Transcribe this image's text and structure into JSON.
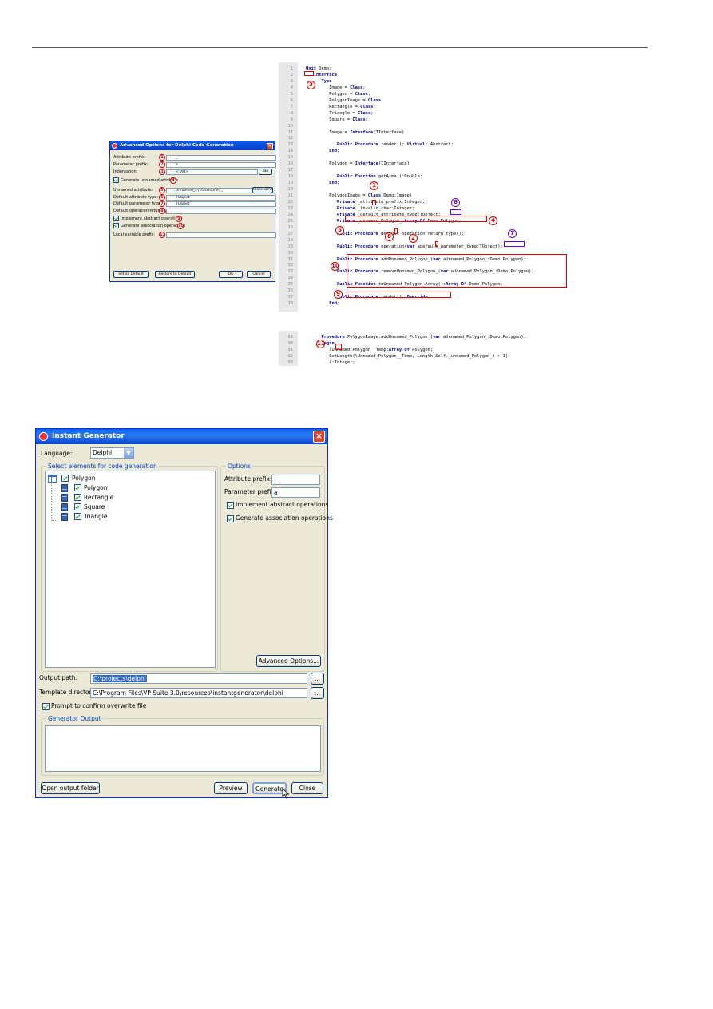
{
  "advanced_dialog": {
    "title": "Advanced Options for Delphi Code Generation",
    "rows": [
      {
        "label": "Attribute prefix:",
        "value": "_",
        "num": "1"
      },
      {
        "label": "Parameter prefix:",
        "value": "a",
        "num": "2"
      },
      {
        "label": "Indentation:",
        "value": "<TAB>",
        "num": "3",
        "button": "Tab"
      },
      {
        "label": "Generate unnamed attribute",
        "num": "4",
        "checkbox": true
      },
      {
        "label": "Unnamed attribute:",
        "value": "Unnamed_${classname}_",
        "num": "5",
        "button": "Classname"
      },
      {
        "label": "Default attribute type:",
        "value": "TObject",
        "num": "6"
      },
      {
        "label": "Default parameter type:",
        "value": "TObject",
        "num": "7"
      },
      {
        "label": "Default operation return type:",
        "value": "",
        "num": "8"
      },
      {
        "label": "Implement abstract operations",
        "num": "9",
        "checkbox": true
      },
      {
        "label": "Generate association operations",
        "num": "10",
        "checkbox": true
      },
      {
        "label": "Local variable prefix:",
        "value": "l",
        "num": "11"
      }
    ],
    "buttons": {
      "set_default": "Set as Default",
      "restore": "Restore to Default",
      "ok": "OK",
      "cancel": "Cancel"
    }
  },
  "code": {
    "lines": [
      {
        "n": "1",
        "t": "Unit Demo;"
      },
      {
        "n": "2",
        "t": "   Interface"
      },
      {
        "n": "3",
        "t": "      Type"
      },
      {
        "n": "4",
        "t": "         Image = Class;"
      },
      {
        "n": "5",
        "t": "         Polygon = Class;"
      },
      {
        "n": "6",
        "t": "         PolygonImage = Class;"
      },
      {
        "n": "7",
        "t": "         Rectangle = Class;"
      },
      {
        "n": "8",
        "t": "         Triangle = Class;"
      },
      {
        "n": "9",
        "t": "         Square = Class;"
      },
      {
        "n": "10",
        "t": ""
      },
      {
        "n": "11",
        "t": "         Image = Interface(IInterface)"
      },
      {
        "n": "12",
        "t": ""
      },
      {
        "n": "13",
        "t": "            Public Procedure render(); Virtual; Abstract;"
      },
      {
        "n": "14",
        "t": "         End;"
      },
      {
        "n": "15",
        "t": ""
      },
      {
        "n": "16",
        "t": "         Polygon = Interface(IInterface)"
      },
      {
        "n": "17",
        "t": ""
      },
      {
        "n": "18",
        "t": "            Public Function getArea():Double;"
      },
      {
        "n": "19",
        "t": "         End;"
      },
      {
        "n": "20",
        "t": ""
      },
      {
        "n": "21",
        "t": "         PolygonImage = Class(Demo.Image)"
      },
      {
        "n": "22",
        "t": "            Private _attribute_prefix:Integer;"
      },
      {
        "n": "23",
        "t": "            Private _invalid_char:Integer;"
      },
      {
        "n": "24",
        "t": "            Private _default_attribute_type:TObject;"
      },
      {
        "n": "25",
        "t": "            Private _unnamed_Polygon_:Array Of Demo.Polygon;"
      },
      {
        "n": "26",
        "t": ""
      },
      {
        "n": "27",
        "t": "            Public Procedure default_operation_return_type();"
      },
      {
        "n": "28",
        "t": ""
      },
      {
        "n": "29",
        "t": "            Public Procedure operation(var adefault_parameter_type:TObject);"
      },
      {
        "n": "30",
        "t": ""
      },
      {
        "n": "31",
        "t": "            Public Procedure addUnnamed_Polygon_(var aUnnamed_Polygon_:Demo.Polygon);"
      },
      {
        "n": "32",
        "t": ""
      },
      {
        "n": "33",
        "t": "            Public Procedure removeUnnamed_Polygon_(var aUnnamed_Polygon_:Demo.Polygon);"
      },
      {
        "n": "34",
        "t": ""
      },
      {
        "n": "35",
        "t": "            Public Function toUnnamed_Polygon_Array():Array Of Demo.Polygon;"
      },
      {
        "n": "36",
        "t": ""
      },
      {
        "n": "37",
        "t": "            Public Procedure render(); Override;"
      },
      {
        "n": "38",
        "t": "         End;"
      }
    ],
    "lines2": [
      {
        "n": "89",
        "t": "      Procedure PolygonImage.addUnnamed_Polygon_(var aUnnamed_Polygon_:Demo.Polygon);"
      },
      {
        "n": "90",
        "t": "      Begin"
      },
      {
        "n": "91",
        "t": "         lUnnamed_Polygon__Temp:Array Of Polygon;"
      },
      {
        "n": "92",
        "t": "         SetLength(lUnnamed_Polygon__Temp, Length(Self._unnamed_Polygon_) + 1);"
      },
      {
        "n": "93",
        "t": "         i:Integer;"
      }
    ],
    "callouts": [
      "1",
      "2",
      "3",
      "4",
      "5",
      "6",
      "7",
      "8",
      "9",
      "10",
      "11"
    ]
  },
  "generator": {
    "title": "Instant Generator",
    "language_label": "Language:",
    "language_value": "Delphi",
    "select_group": "Select elements for code generation",
    "tree": {
      "root": "Polygon",
      "children": [
        "Polygon",
        "Rectangle",
        "Square",
        "Triangle"
      ]
    },
    "options_group": "Options",
    "attr_prefix_label": "Attribute prefix:",
    "attr_prefix_value": "_",
    "param_prefix_label": "Parameter prefix:",
    "param_prefix_value": "a",
    "implement_abstract": "Implement abstract operations",
    "generate_association": "Generate association operations",
    "advanced_button": "Advanced Options...",
    "output_path_label": "Output path:",
    "output_path_value": "C:\\projects\\delphi",
    "template_dir_label": "Template directory:",
    "template_dir_value": "C:\\Program Files\\VP Suite 3.0\\resources\\instantgenerator\\delphi",
    "browse": "...",
    "prompt_confirm": "Prompt to confirm overwrite file",
    "generator_output_group": "Generator Output",
    "buttons": {
      "open_output": "Open output folder",
      "preview": "Preview",
      "generate": "Generate",
      "close": "Close"
    }
  }
}
